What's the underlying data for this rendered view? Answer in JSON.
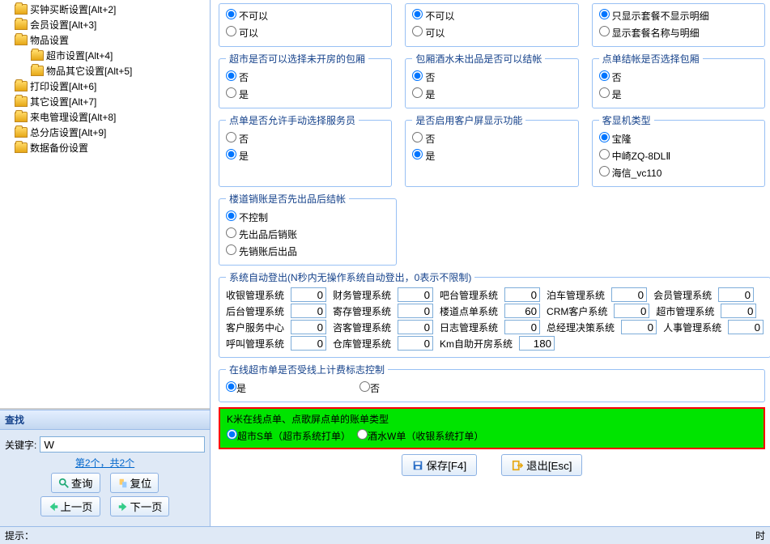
{
  "tree": [
    {
      "label": "买钟买断设置[Alt+2]",
      "indent": false
    },
    {
      "label": "会员设置[Alt+3]",
      "indent": false
    },
    {
      "label": "物品设置",
      "indent": false
    },
    {
      "label": "超市设置[Alt+4]",
      "indent": true
    },
    {
      "label": "物品其它设置[Alt+5]",
      "indent": true
    },
    {
      "label": "打印设置[Alt+6]",
      "indent": false
    },
    {
      "label": "其它设置[Alt+7]",
      "indent": false
    },
    {
      "label": "来电管理设置[Alt+8]",
      "indent": false
    },
    {
      "label": "总分店设置[Alt+9]",
      "indent": false
    },
    {
      "label": "数据备份设置",
      "indent": false
    }
  ],
  "search": {
    "title": "查找",
    "keyword_label": "关键字:",
    "keyword_value": "W",
    "info": "第2个，共2个",
    "btn_query": "查询",
    "btn_reset": "复位",
    "btn_prev": "上一页",
    "btn_next": "下一页"
  },
  "groups": {
    "g1a": {
      "opts": [
        "不可以",
        "可以"
      ],
      "sel": 0
    },
    "g1b": {
      "opts": [
        "不可以",
        "可以"
      ],
      "sel": 0
    },
    "g1c": {
      "opts": [
        "只显示套餐不显示明细",
        "显示套餐名称与明细"
      ],
      "sel": 0
    },
    "g2a": {
      "title": "超市是否可以选择未开房的包厢",
      "opts": [
        "否",
        "是"
      ],
      "sel": 0
    },
    "g2b": {
      "title": "包厢酒水未出品是否可以结帐",
      "opts": [
        "否",
        "是"
      ],
      "sel": 0
    },
    "g2c": {
      "title": "点单结帐是否选择包厢",
      "opts": [
        "否",
        "是"
      ],
      "sel": 0
    },
    "g3a": {
      "title": "点单是否允许手动选择服务员",
      "opts": [
        "否",
        "是"
      ],
      "sel": 1
    },
    "g3b": {
      "title": "是否启用客户屏显示功能",
      "opts": [
        "否",
        "是"
      ],
      "sel": 1
    },
    "g3c": {
      "title": "客显机类型",
      "opts": [
        "宝隆",
        "中崎ZQ-8DLⅡ",
        "海信_vc110"
      ],
      "sel": 0
    },
    "g4": {
      "title": "楼道销账是否先出品后结帐",
      "opts": [
        "不控制",
        "先出品后销账",
        "先销账后出品"
      ],
      "sel": 0
    },
    "logout": {
      "title": "系统自动登出(N秒内无操作系统自动登出，0表示不限制)",
      "rows": [
        {
          "l1": "收银管理系统",
          "v1": "0",
          "l2": "财务管理系统",
          "v2": "0",
          "l3": "吧台管理系统",
          "v3": "0",
          "l4": "泊车管理系统",
          "v4": "0",
          "l5": "会员管理系统",
          "v5": "0"
        },
        {
          "l1": "后台管理系统",
          "v1": "0",
          "l2": "寄存管理系统",
          "v2": "0",
          "l3": "楼道点单系统",
          "v3": "60",
          "l4": "CRM客户系统",
          "v4": "0",
          "l5": "超市管理系统",
          "v5": "0"
        },
        {
          "l1": "客户服务中心",
          "v1": "0",
          "l2": "咨客管理系统",
          "v2": "0",
          "l3": "日志管理系统",
          "v3": "0",
          "l4": "总经理决策系统",
          "v4": "0",
          "l5": "人事管理系统",
          "v5": "0"
        },
        {
          "l1": "呼叫管理系统",
          "v1": "0",
          "l2": "仓库管理系统",
          "v2": "0",
          "l3": "Km自助开房系统",
          "v3": "180"
        }
      ]
    },
    "online": {
      "title": "在线超市单是否受线上计费标志控制",
      "opts": [
        "是",
        "否"
      ],
      "sel": 0
    },
    "highlight": {
      "title": "K米在线点单、点歌屏点单的账单类型",
      "opts": [
        "超市S单（超市系统打单）",
        "酒水W单（收银系统打单）"
      ],
      "sel": 0
    }
  },
  "bottom": {
    "save": "保存[F4]",
    "exit": "退出[Esc]"
  },
  "status": {
    "left": "提示：",
    "right": "时"
  }
}
